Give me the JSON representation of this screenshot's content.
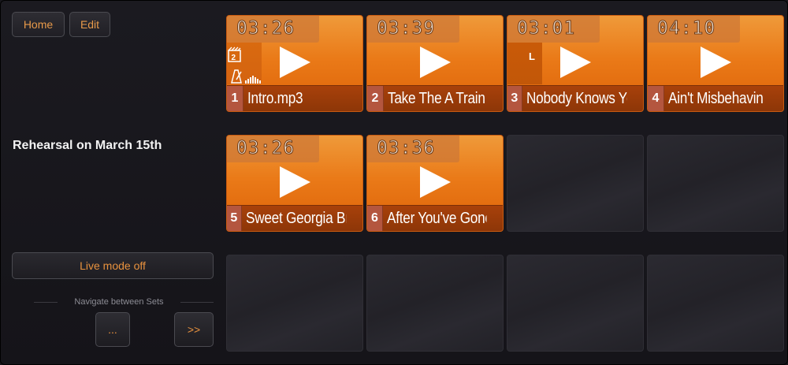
{
  "toolbar": {
    "home_label": "Home",
    "edit_label": "Edit"
  },
  "set": {
    "title": "Rehearsal on March 15th"
  },
  "live_mode": {
    "label": "Live mode off"
  },
  "navigation": {
    "label": "Navigate between Sets",
    "prev_label": "...",
    "next_label": ">>"
  },
  "colors": {
    "accent": "#e8923e",
    "tile_orange": "#ea7a18",
    "tile_bottom": "#8d3608",
    "background": "#18171c"
  },
  "songs": [
    {
      "number": "1",
      "title": "Intro.mp3",
      "duration": "03:26",
      "icons": [
        "set-two-icon",
        "metronome-icon",
        "volume-level-icon"
      ]
    },
    {
      "number": "2",
      "title": "Take The A Train",
      "duration": "03:39"
    },
    {
      "number": "3",
      "title": "Nobody Knows You",
      "duration": "03:01",
      "marker": "L"
    },
    {
      "number": "4",
      "title": "Ain't Misbehavin",
      "duration": "04:10"
    },
    {
      "number": "5",
      "title": "Sweet Georgia Bro.",
      "duration": "03:26"
    },
    {
      "number": "6",
      "title": "After You've Gone",
      "duration": "03:36"
    }
  ]
}
